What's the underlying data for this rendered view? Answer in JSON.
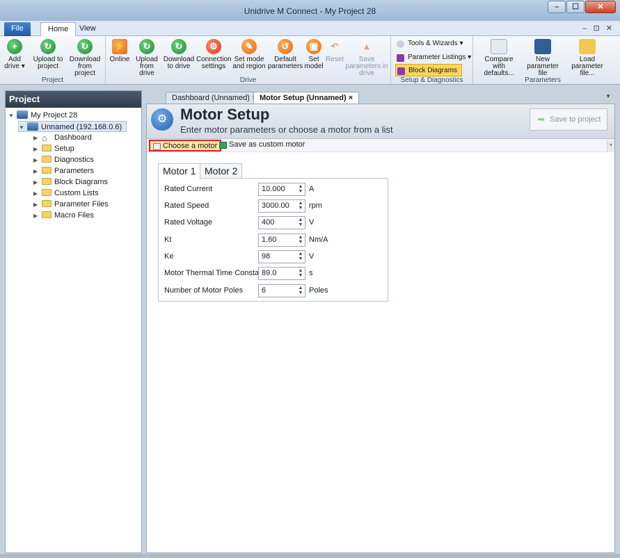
{
  "window": {
    "title": "Unidrive M Connect - My Project 28",
    "minimize": "–",
    "maximize": "☐",
    "close": "✕"
  },
  "ribbon_tabs": {
    "file": "File",
    "home": "Home",
    "view": "View",
    "controls": "– ⊡ ✕"
  },
  "ribbon": {
    "project_group": {
      "label": "Project",
      "add_drive": "Add drive ▾",
      "upload_to_project": "Upload to project",
      "download_from_project": "Download from project"
    },
    "drive_group": {
      "label": "Drive",
      "online": "Online",
      "upload_from_drive": "Upload from drive",
      "download_to_drive": "Download to drive",
      "connection_settings": "Connection settings",
      "set_mode_region": "Set mode and region",
      "default_parameters": "Default parameters",
      "set_model": "Set model",
      "reset": "Reset",
      "save_parameters": "Save parameters in drive"
    },
    "setup_group": {
      "label": "Setup & Diagnostics",
      "tools_wizards": "Tools & Wizards ▾",
      "parameter_listings": "Parameter Listings ▾",
      "block_diagrams": "Block Diagrams"
    },
    "parameters_group": {
      "label": "Parameters",
      "compare_defaults": "Compare with defaults...",
      "new_parameter_file": "New parameter file",
      "load_parameter_file": "Load parameter file..."
    }
  },
  "project_panel": {
    "title": "Project",
    "tree": {
      "root": "My Project 28",
      "drive": "Unnamed (192.168.0.6)",
      "items": [
        "Dashboard",
        "Setup",
        "Diagnostics",
        "Parameters",
        "Block Diagrams",
        "Custom Lists",
        "Parameter Files",
        "Macro Files"
      ]
    }
  },
  "doc_tabs": [
    {
      "label": "Dashboard (Unnamed)  ×"
    },
    {
      "label": "Motor Setup (Unnamed)  ×"
    }
  ],
  "motor_setup": {
    "title": "Motor Setup",
    "subtitle": "Enter motor parameters or choose a motor from a list",
    "save_to_project": "Save to project",
    "choose_motor": "Choose a motor",
    "save_custom": "Save as custom motor",
    "motor_tabs": [
      "Motor 1",
      "Motor 2"
    ],
    "parameters": [
      {
        "label": "Rated Current",
        "value": "10.000",
        "unit": "A"
      },
      {
        "label": "Rated Speed",
        "value": "3000.00",
        "unit": "rpm"
      },
      {
        "label": "Rated Voltage",
        "value": "400",
        "unit": "V"
      },
      {
        "label": "Kt",
        "value": "1.60",
        "unit": "Nm/A"
      },
      {
        "label": "Ke",
        "value": "98",
        "unit": "V"
      },
      {
        "label": "Motor Thermal Time Constant",
        "value": "89.0",
        "unit": "s"
      },
      {
        "label": "Number of Motor Poles",
        "value": "6",
        "unit": "Poles"
      }
    ]
  }
}
